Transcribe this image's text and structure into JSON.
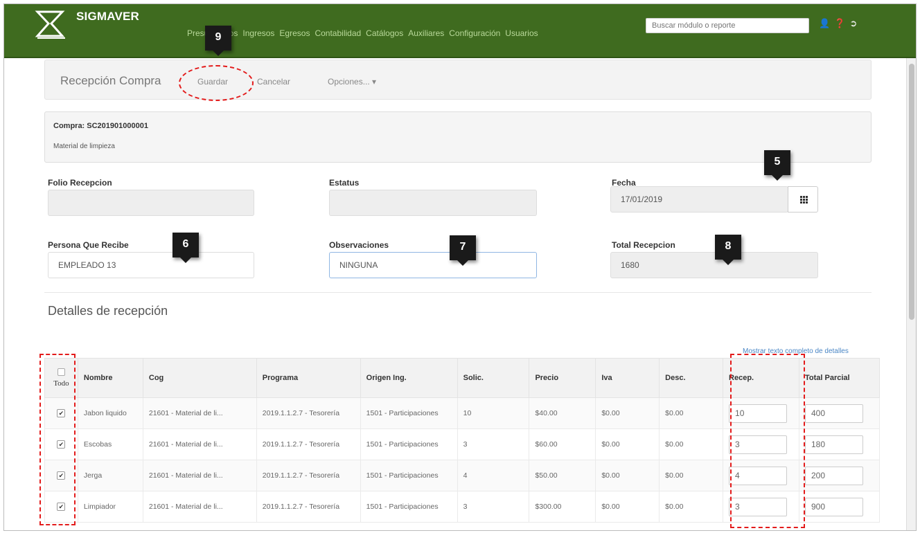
{
  "app": {
    "brand": "SIGMAVER"
  },
  "nav": {
    "items": [
      "Presupuestos",
      "Ingresos",
      "Egresos",
      "Contabilidad",
      "Catálogos",
      "Auxiliares",
      "Configuración",
      "Usuarios"
    ],
    "search_placeholder": "Buscar módulo o reporte",
    "icons": [
      "user-icon",
      "help-icon",
      "logout-icon"
    ]
  },
  "toolbar": {
    "title": "Recepción Compra",
    "save_label": "Guardar",
    "cancel_label": "Cancelar",
    "options_label": "Opciones... ▾"
  },
  "compra": {
    "header": "Compra: SC201901000001",
    "description": "Material de limpieza"
  },
  "form": {
    "folio_label": "Folio Recepcion",
    "folio_value": "",
    "estatus_label": "Estatus",
    "estatus_value": "",
    "fecha_label": "Fecha",
    "fecha_value": "17/01/2019",
    "persona_label": "Persona Que Recibe",
    "persona_value": "EMPLEADO 13",
    "observaciones_label": "Observaciones",
    "observaciones_value": "NINGUNA",
    "total_label": "Total Recepcion",
    "total_value": "1680"
  },
  "details": {
    "title": "Detalles de recepción",
    "show_full_link": "Mostrar texto completo de detalles",
    "columns": {
      "todo": "Todo",
      "nombre": "Nombre",
      "cog": "Cog",
      "programa": "Programa",
      "origen": "Origen Ing.",
      "solic": "Solic.",
      "precio": "Precio",
      "iva": "Iva",
      "desc": "Desc.",
      "recep": "Recep.",
      "total": "Total Parcial"
    },
    "rows": [
      {
        "checked": true,
        "nombre": "Jabon liquido",
        "cog": "21601 - Material de li...",
        "programa": "2019.1.1.2.7 - Tesorería",
        "origen": "1501 - Participaciones",
        "solic": "10",
        "precio": "$40.00",
        "iva": "$0.00",
        "desc": "$0.00",
        "recep": "10",
        "total": "400"
      },
      {
        "checked": true,
        "nombre": "Escobas",
        "cog": "21601 - Material de li...",
        "programa": "2019.1.1.2.7 - Tesorería",
        "origen": "1501 - Participaciones",
        "solic": "3",
        "precio": "$60.00",
        "iva": "$0.00",
        "desc": "$0.00",
        "recep": "3",
        "total": "180"
      },
      {
        "checked": true,
        "nombre": "Jerga",
        "cog": "21601 - Material de li...",
        "programa": "2019.1.1.2.7 - Tesorería",
        "origen": "1501 - Participaciones",
        "solic": "4",
        "precio": "$50.00",
        "iva": "$0.00",
        "desc": "$0.00",
        "recep": "4",
        "total": "200"
      },
      {
        "checked": true,
        "nombre": "Limpiador",
        "cog": "21601 - Material de li...",
        "programa": "2019.1.1.2.7 - Tesorería",
        "origen": "1501 - Participaciones",
        "solic": "3",
        "precio": "$300.00",
        "iva": "$0.00",
        "desc": "$0.00",
        "recep": "3",
        "total": "900"
      }
    ]
  },
  "callouts": {
    "c5": "5",
    "c6": "6",
    "c7": "7",
    "c8": "8",
    "c9": "9"
  },
  "colors": {
    "navbar": "#3f6b1f",
    "highlight": "#e31b1b",
    "link": "#4a86c5"
  }
}
